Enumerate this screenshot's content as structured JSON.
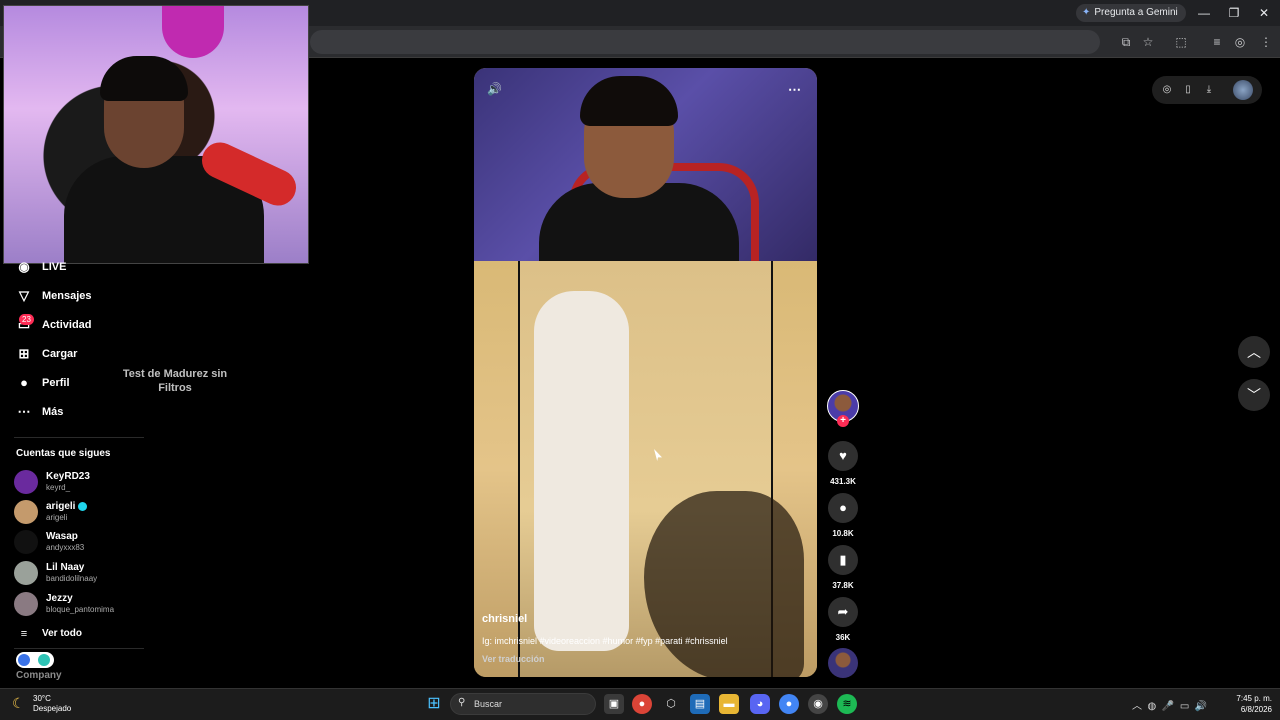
{
  "browser": {
    "gemini_label": "Pregunta a Gemini",
    "window_controls": [
      "minimize-icon",
      "restore-icon",
      "close-icon"
    ],
    "toolbar_icons": [
      "install-app-icon",
      "bookmark-star-icon",
      "extensions-icon",
      "media-controls-icon",
      "profile-icon",
      "menu-icon"
    ]
  },
  "sidebar": {
    "items": [
      {
        "label": "LIVE",
        "icon": "live-icon"
      },
      {
        "label": "Mensajes",
        "icon": "messages-icon"
      },
      {
        "label": "Actividad",
        "icon": "activity-icon",
        "badge": "23"
      },
      {
        "label": "Cargar",
        "icon": "upload-icon"
      },
      {
        "label": "Perfil",
        "icon": "profile-icon"
      },
      {
        "label": "Más",
        "icon": "more-icon"
      }
    ],
    "following_header": "Cuentas que sigues",
    "accounts": [
      {
        "name": "KeyRD23",
        "handle": "keyrd_"
      },
      {
        "name": "arigeli",
        "handle": "arigeli",
        "verified": true
      },
      {
        "name": "Wasap",
        "handle": "andyxxx83"
      },
      {
        "name": "Lil  Naay",
        "handle": "bandidolilnaay"
      },
      {
        "name": "Jezzy",
        "handle": "bloque_pantomima"
      }
    ],
    "see_all": "Ver todo",
    "company": "Company"
  },
  "video": {
    "overlay_text": "Test de Madurez sin Filtros",
    "username": "chrisniel",
    "description": "Ig: imchrisniel #videoreaccion #humor #fyp #parati #chrissniel",
    "translate": "Ver traducción"
  },
  "actions": {
    "likes": "431.3K",
    "comments": "10.8K",
    "saves": "37.8K",
    "shares": "36K"
  },
  "taskbar": {
    "weather_temp": "30°C",
    "weather_desc": "Despejado",
    "search_label": "Buscar",
    "time": "7:45 p. m.",
    "date": "6/8/2026"
  },
  "colors": {
    "accent": "#fe2c55",
    "verified": "#20d5ec"
  }
}
